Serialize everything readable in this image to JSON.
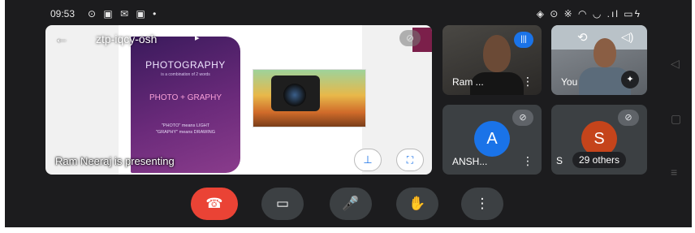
{
  "status_bar": {
    "time": "09:53",
    "left_icons": "⊙ ▣ ✉ ▣ •",
    "right_icons": "◈ ⊙ ※ ◠ ◡ .ıl ▭ϟ"
  },
  "meeting": {
    "code": "ztp-iqcy-osh",
    "caret": "▸",
    "presenting_label": "Ram Neeraj is presenting"
  },
  "slide": {
    "title": "PHOTOGRAPHY",
    "subtitle": "is a combination of 2 words",
    "middle": "PHOTO + GRAPHY",
    "footer_line1": "\"PHOTO\" means LIGHT",
    "footer_line2": "\"GRAPHY\" means DRAWING"
  },
  "participants": {
    "ram": {
      "name": "Ram ...",
      "speaking_icon": "|||"
    },
    "you": {
      "name": "You"
    },
    "ansh": {
      "name": "ANSH...",
      "initial": "A",
      "color": "#1a73e8"
    },
    "others": {
      "partial_name": "S",
      "initial": "S",
      "color": "#c5441b",
      "count_label": "29 others"
    }
  },
  "icons": {
    "back": "←",
    "mic_off": "⊘",
    "pin": "⊥",
    "fullscreen": "⛶",
    "more": "⋮",
    "switch_camera": "⟲",
    "speaker": "◁)",
    "effects": "✦",
    "end_call": "☎",
    "camera": "▭",
    "mic": "🎤",
    "hand": "✋",
    "nav_back": "◁",
    "nav_home": "▢",
    "nav_recent": "≡"
  }
}
